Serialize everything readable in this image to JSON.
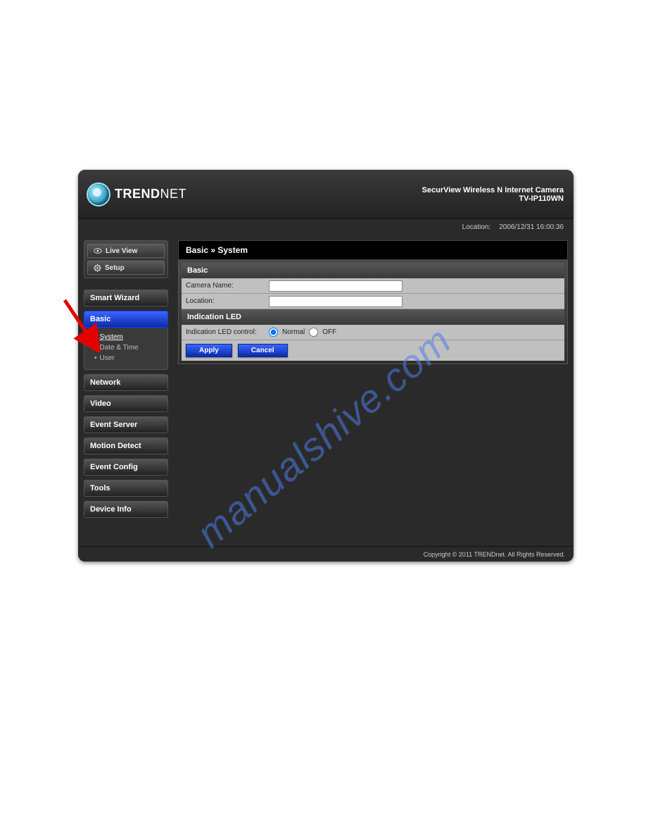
{
  "brand": {
    "text": "TRENDNET",
    "thin_part": "NET"
  },
  "product": {
    "title_line1": "SecurView Wireless N Internet Camera",
    "title_line2": "TV-IP110WN"
  },
  "subheader": {
    "location_label": "Location:",
    "timestamp": "2006/12/31 16:00:36"
  },
  "side_buttons": {
    "live_view": "Live View",
    "setup": "Setup"
  },
  "nav": {
    "smart_wizard": "Smart Wizard",
    "basic": "Basic",
    "network": "Network",
    "video": "Video",
    "event_server": "Event Server",
    "motion_detect": "Motion Detect",
    "event_config": "Event Config",
    "tools": "Tools",
    "device_info": "Device Info"
  },
  "subnav": {
    "system": "System",
    "date_time": "Date & Time",
    "user": "User"
  },
  "breadcrumb": "Basic » System",
  "sections": {
    "basic": "Basic",
    "indication_led": "Indication LED"
  },
  "form": {
    "camera_name_label": "Camera Name:",
    "camera_name_value": "",
    "location_label": "Location:",
    "location_value": "",
    "led_control_label": "Indication LED control:",
    "led_normal": "Normal",
    "led_off": "OFF",
    "led_selected": "normal"
  },
  "buttons": {
    "apply": "Apply",
    "cancel": "Cancel"
  },
  "footer": "Copyright © 2011 TRENDnet. All Rights Reserved.",
  "watermark": "manualshive.com"
}
